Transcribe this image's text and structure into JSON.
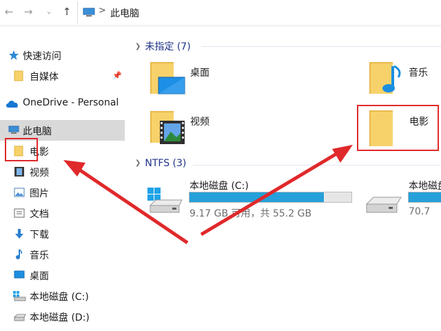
{
  "address_bar": {
    "path": "此电脑",
    "separator": ">",
    "back_icon": "←",
    "forward_icon": "→",
    "recent_icon": "⌄",
    "up_icon": "↑"
  },
  "sidebar": {
    "quick_access": "快速访问",
    "pinned_folder": "自媒体",
    "onedrive": "OneDrive - Personal",
    "this_pc": "此电脑",
    "items": [
      {
        "label": "电影"
      },
      {
        "label": "视频"
      },
      {
        "label": "图片"
      },
      {
        "label": "文档"
      },
      {
        "label": "下载"
      },
      {
        "label": "音乐"
      },
      {
        "label": "桌面"
      },
      {
        "label": "本地磁盘 (C:)"
      },
      {
        "label": "本地磁盘 (D:)"
      }
    ]
  },
  "main": {
    "group1_header": "未指定 (7)",
    "folders": [
      {
        "label": "桌面"
      },
      {
        "label": "音乐"
      },
      {
        "label": "视频"
      },
      {
        "label": "电影"
      }
    ],
    "group2_header": "NTFS (3)",
    "drives": [
      {
        "label": "本地磁盘 (C:)",
        "usage": "9.17 GB 可用，共 55.2 GB",
        "used_fraction": 0.83
      },
      {
        "label": "本地磁盘",
        "usage": "70.7",
        "used_fraction": 0.9
      }
    ]
  },
  "colors": {
    "accent": "#26a0da",
    "annotation_red": "#e0292b",
    "folder_yellow": "#f7d26b",
    "selection": "#d9d9d9"
  }
}
